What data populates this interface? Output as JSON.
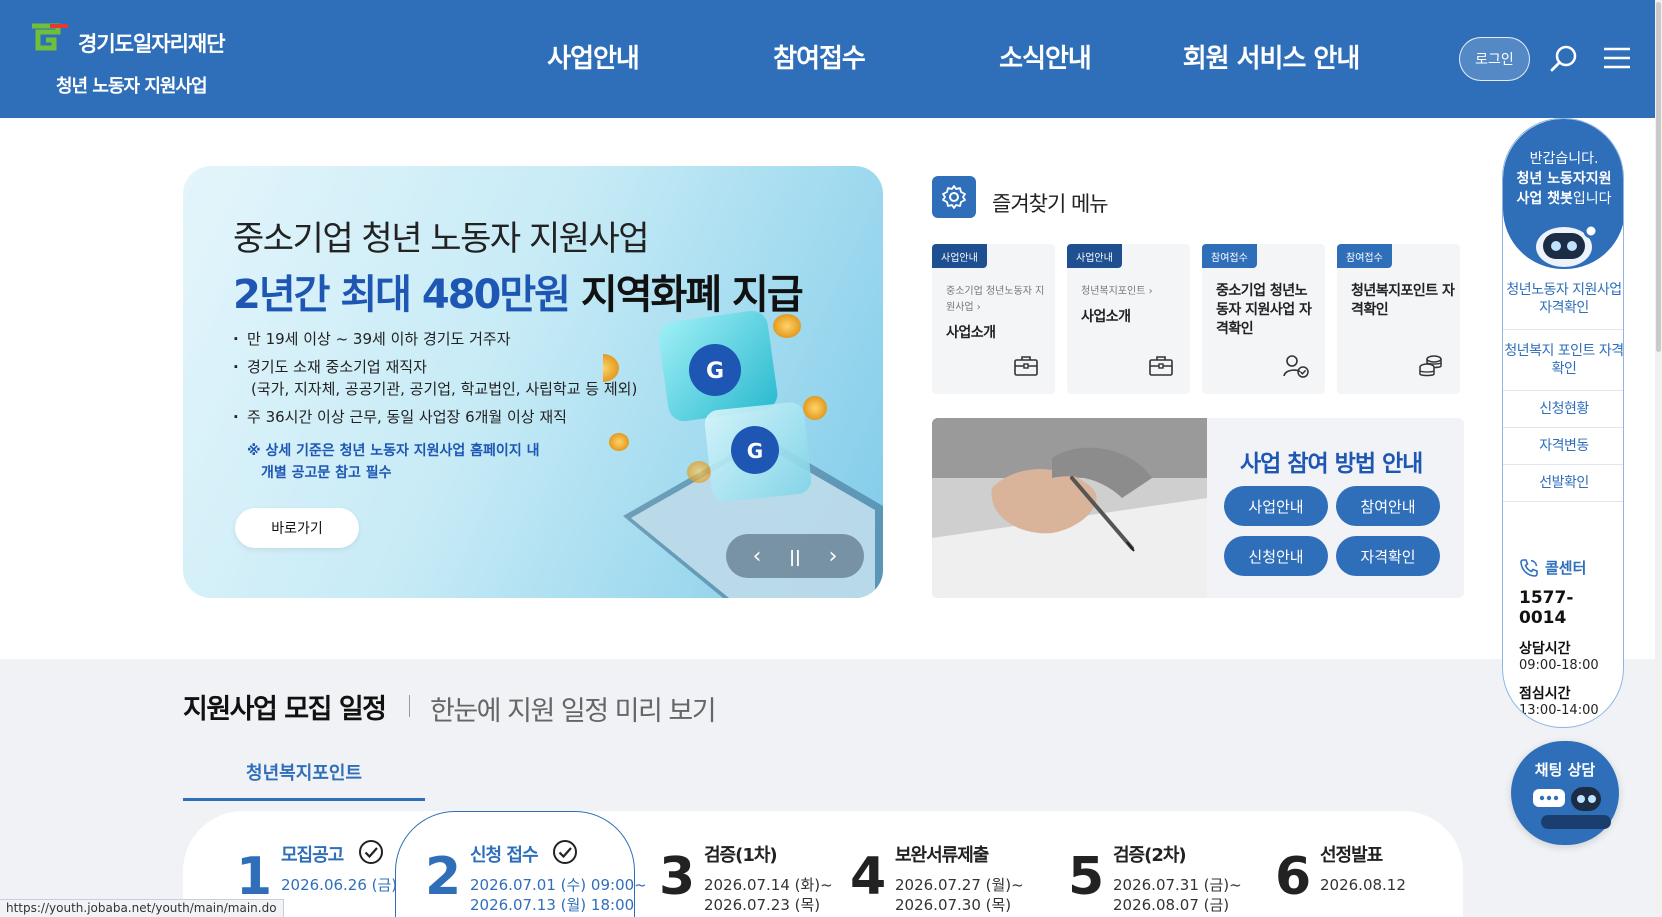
{
  "header": {
    "logo_name": "경기도일자리재단",
    "logo_sub": "청년 노동자 지원사업",
    "nav": [
      "사업안내",
      "참여접수",
      "소식안내",
      "회원 서비스 안내"
    ],
    "login_label": "로그인",
    "icons": {
      "search": "search-icon",
      "menu": "hamburger-menu-icon"
    },
    "colors": {
      "primary": "#2f6fba"
    }
  },
  "banner": {
    "title": "중소기업 청년 노동자 지원사업",
    "headline_blue": "2년간 최대 480만원",
    "headline_dark": "지역화폐 지급",
    "bullets": [
      "만 19세 이상 ~ 39세 이하 경기도 거주자",
      "경기도 소재 중소기업 재직자",
      "(국가, 지자체, 공공기관, 공기업, 학교법인, 사립학교 등 제외)",
      "주 36시간 이상 근무, 동일 사업장 6개월 이상 재직"
    ],
    "note_line1": "※ 상세 기준은 청년 노동자 지원사업 홈페이지 내",
    "note_line2": "개별 공고문 참고 필수",
    "button_label": "바로가기",
    "controls": {
      "prev": "‹",
      "pause": "||",
      "next": "›"
    }
  },
  "favorites": {
    "title": "즐겨찾기 메뉴",
    "cards": [
      {
        "tag": "사업안내",
        "small": "중소기업 청년노동자 지원사업 ›",
        "main": "사업소개",
        "icon": "briefcase-icon"
      },
      {
        "tag": "사업안내",
        "small": "청년복지포인트 ›",
        "main": "사업소개",
        "icon": "briefcase-icon"
      },
      {
        "tag": "참여접수",
        "small": "",
        "main": "중소기업 청년노동자 지원사업 자격확인",
        "icon": "user-check-icon"
      },
      {
        "tag": "참여접수",
        "small": "",
        "main": "청년복지포인트 자격확인",
        "icon": "coins-icon"
      }
    ]
  },
  "guide": {
    "title": "사업 참여 방법 안내",
    "buttons": [
      "사업안내",
      "참여안내",
      "신청안내",
      "자격확인"
    ]
  },
  "schedule": {
    "title": "지원사업 모집 일정",
    "subtitle": "한눈에 지원 일정 미리 보기",
    "tab": "청년복지포인트",
    "steps": [
      {
        "num": "1",
        "name": "모집공고",
        "date1": "2026.06.26 (금)",
        "date2": ""
      },
      {
        "num": "2",
        "name": "신청 접수",
        "date1": "2026.07.01 (수) 09:00~",
        "date2": "2026.07.13 (월) 18:00"
      },
      {
        "num": "3",
        "name": "검증(1차)",
        "date1": "2026.07.14 (화)~",
        "date2": "2026.07.23 (목)"
      },
      {
        "num": "4",
        "name": "보완서류제출",
        "date1": "2026.07.27 (월)~",
        "date2": "2026.07.30 (목)"
      },
      {
        "num": "5",
        "name": "검증(2차)",
        "date1": "2026.07.31 (금)~",
        "date2": "2026.08.07 (금)"
      },
      {
        "num": "6",
        "name": "선정발표",
        "date1": "2026.08.12",
        "date2": ""
      }
    ]
  },
  "quick": {
    "greet1": "반갑습니다.",
    "greet2": "청년 노동자지원",
    "greet3_bold": "사업 챗봇",
    "greet3_rest": "입니다",
    "links": [
      "청년노동자 지원사업 자격확인",
      "청년복지 포인트 자격확인",
      "신청현황",
      "자격변동",
      "선발확인"
    ],
    "callcenter_label": "콜센터",
    "callcenter_number": "1577-0014",
    "hours_label": "상담시간",
    "hours": "09:00-18:00",
    "lunch_label": "점심시간",
    "lunch": "13:00-14:00"
  },
  "chat": {
    "label": "채팅 상담"
  },
  "status_url": "https://youth.jobaba.net/youth/main/main.do"
}
